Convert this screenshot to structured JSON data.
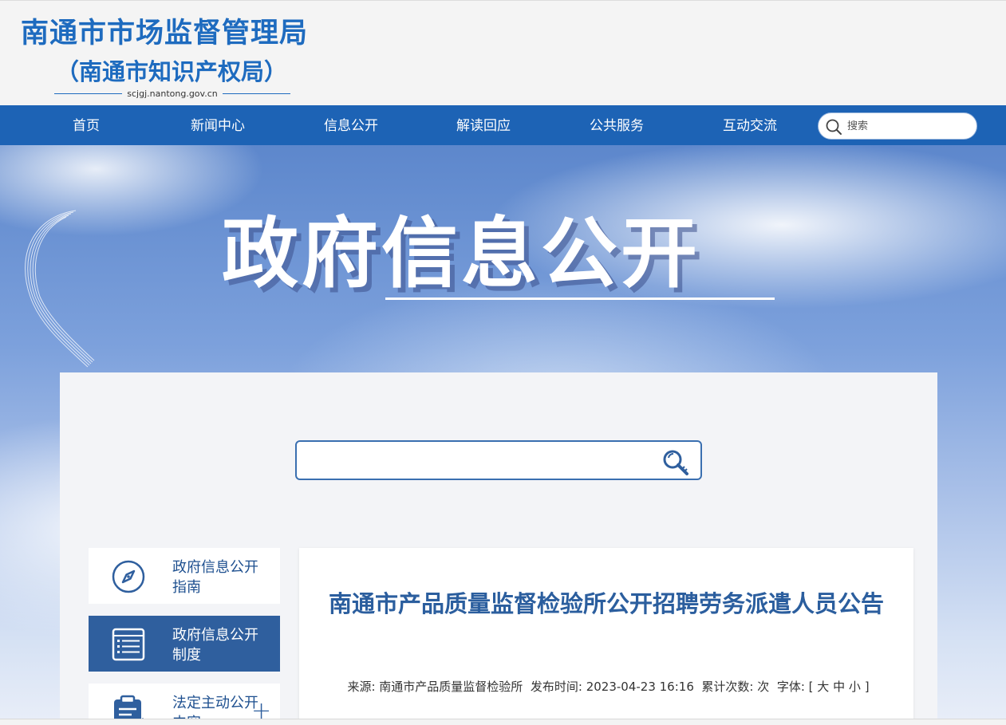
{
  "header": {
    "title": "南通市市场监督管理局",
    "subtitle": "（南通市知识产权局）",
    "domain": "scjgj.nantong.gov.cn"
  },
  "nav": {
    "items": [
      {
        "label": "首页"
      },
      {
        "label": "新闻中心"
      },
      {
        "label": "信息公开"
      },
      {
        "label": "解读回应"
      },
      {
        "label": "公共服务"
      },
      {
        "label": "互动交流"
      }
    ],
    "search_placeholder": "搜索",
    "search_icon": "search-icon"
  },
  "banner": {
    "title": "政府信息公开"
  },
  "main_search": {
    "value": "",
    "icon": "magnifier-key-icon"
  },
  "sidebar": {
    "items": [
      {
        "label": "政府信息公开指南",
        "icon": "compass-icon",
        "active": false
      },
      {
        "label": "政府信息公开制度",
        "icon": "list-document-icon",
        "active": true
      },
      {
        "label": "法定主动公开内容",
        "icon": "clipboard-edit-icon",
        "active": false,
        "expand": "+"
      }
    ]
  },
  "article": {
    "title": "南通市产品质量监督检验所公开招聘劳务派遣人员公告",
    "source_label": "来源:",
    "source": "南通市产品质量监督检验所",
    "time_label": "发布时间:",
    "time": "2023-04-23 16:16",
    "views_label": "累计次数:",
    "views_value": "",
    "views_unit": "次",
    "font_label": "字体:",
    "font_open": "[",
    "font_large": "大",
    "font_medium": "中",
    "font_small": "小",
    "font_close": "]"
  },
  "colors": {
    "brand_blue": "#1d63b5",
    "title_blue": "#1e6bbf",
    "sidebar_active": "#2f5f9e",
    "article_title": "#2b5e9e"
  }
}
